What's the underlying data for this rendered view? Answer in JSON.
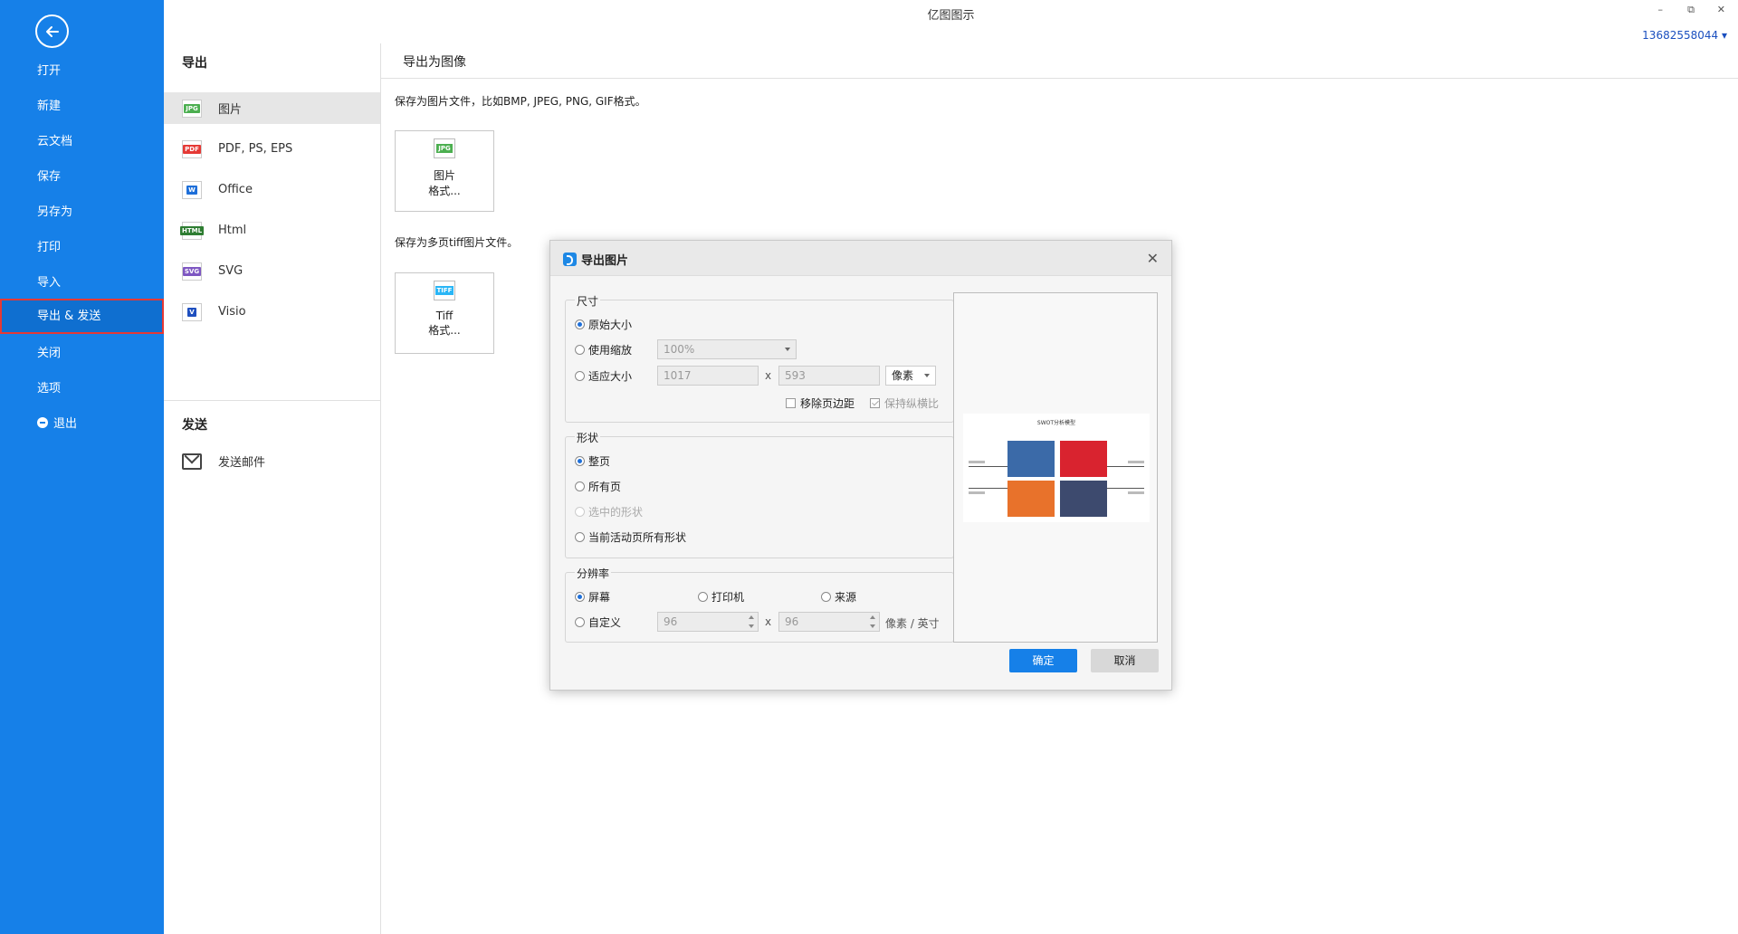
{
  "app": {
    "title": "亿图图示",
    "account": "13682558044 ▾"
  },
  "window_controls": {
    "minimize": "–",
    "restore": "⧉",
    "close": "✕"
  },
  "sidebar": {
    "items": [
      {
        "label": "打开"
      },
      {
        "label": "新建"
      },
      {
        "label": "云文档"
      },
      {
        "label": "保存"
      },
      {
        "label": "另存为"
      },
      {
        "label": "打印"
      },
      {
        "label": "导入"
      },
      {
        "label": "导出 & 发送",
        "active": true
      },
      {
        "label": "关闭"
      },
      {
        "label": "选项"
      },
      {
        "label": "退出"
      }
    ]
  },
  "export_panel": {
    "heading": "导出",
    "formats": [
      {
        "label": "图片",
        "tag": "JPG",
        "color": "#4caf50"
      },
      {
        "label": "PDF, PS, EPS",
        "tag": "PDF",
        "color": "#e53935"
      },
      {
        "label": "Office",
        "tag": "W",
        "color": "#1e6fd9"
      },
      {
        "label": "Html",
        "tag": "HTML",
        "color": "#2e7d32"
      },
      {
        "label": "SVG",
        "tag": "SVG",
        "color": "#7e57c2"
      },
      {
        "label": "Visio",
        "tag": "V",
        "color": "#1e4fbf"
      }
    ],
    "send_heading": "发送",
    "send_mail": "发送邮件"
  },
  "content": {
    "header": "导出为图像",
    "desc_image": "保存为图片文件，比如BMP, JPEG, PNG, GIF格式。",
    "image_btn": {
      "line1": "图片",
      "line2": "格式...",
      "tag": "JPG"
    },
    "desc_tiff": "保存为多页tiff图片文件。",
    "tiff_btn": {
      "line1": "Tiff",
      "line2": "格式...",
      "tag": "TIFF"
    }
  },
  "dialog": {
    "title": "导出图片",
    "size_group": {
      "title": "尺寸",
      "original": "原始大小",
      "zoom": "使用缩放",
      "zoom_value": "100%",
      "fit": "适应大小",
      "width": "1017",
      "height": "593",
      "x": "x",
      "unit": "像素",
      "remove_margin": "移除页边距",
      "keep_ratio": "保持纵横比"
    },
    "shape_group": {
      "title": "形状",
      "whole_page": "整页",
      "all_pages": "所有页",
      "selected": "选中的形状",
      "active_page": "当前活动页所有形状"
    },
    "resolution_group": {
      "title": "分辨率",
      "screen": "屏幕",
      "printer": "打印机",
      "source": "来源",
      "custom": "自定义",
      "dpi_x": "96",
      "dpi_y": "96",
      "x": "x",
      "unit": "像素 / 英寸"
    },
    "preview_title": "SWOT分析模型",
    "ok": "确定",
    "cancel": "取消"
  }
}
